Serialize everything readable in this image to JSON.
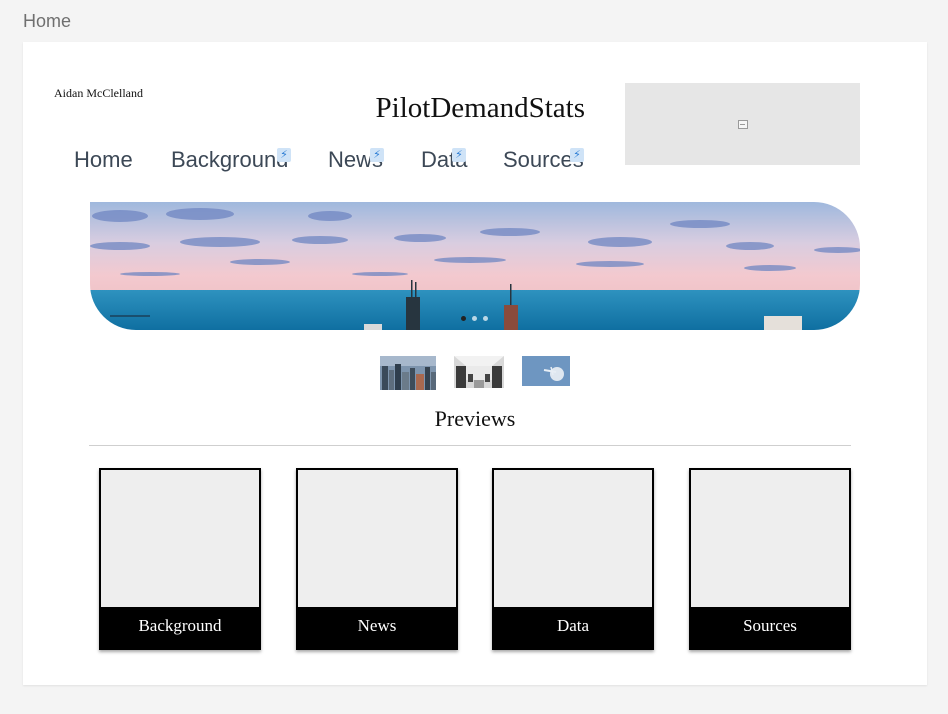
{
  "breadcrumb": "Home",
  "header": {
    "author": "Aidan McClelland",
    "site_title": "PilotDemandStats"
  },
  "nav": {
    "items": [
      {
        "label": "Home",
        "icon": "none"
      },
      {
        "label": "Background",
        "icon": "lightning-icon"
      },
      {
        "label": "News",
        "icon": "lightning-icon"
      },
      {
        "label": "Data",
        "icon": "lightning-icon"
      },
      {
        "label": "Sources",
        "icon": "lightning-icon"
      }
    ]
  },
  "hero": {
    "slide_count": 3,
    "active_slide": 1
  },
  "thumbnails": [
    {
      "icon": "city-skyline-thumbnail"
    },
    {
      "icon": "aircraft-cabin-thumbnail"
    },
    {
      "icon": "airplane-sky-thumbnail"
    }
  ],
  "previews": {
    "heading": "Previews",
    "cards": [
      {
        "label": "Background"
      },
      {
        "label": "News"
      },
      {
        "label": "Data"
      },
      {
        "label": "Sources"
      }
    ]
  },
  "colors": {
    "page_background": "#f4f4f4",
    "card_background": "#ffffff",
    "nav_text": "#3c4856",
    "preview_label_background": "#000000",
    "logo_placeholder": "#e6e6e6"
  }
}
